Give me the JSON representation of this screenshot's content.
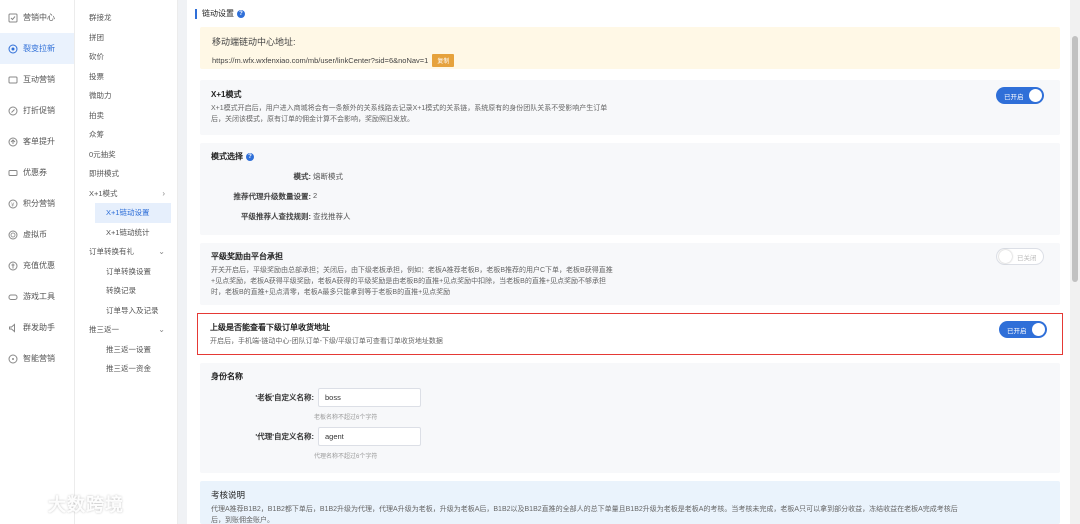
{
  "sidebar_main": {
    "items": [
      {
        "label": "营销中心",
        "icon": "marketing-center-icon"
      },
      {
        "label": "裂变拉新",
        "icon": "fission-icon",
        "active": true
      },
      {
        "label": "互动营销",
        "icon": "interactive-icon"
      },
      {
        "label": "打折促销",
        "icon": "discount-icon"
      },
      {
        "label": "客单提升",
        "icon": "order-up-icon"
      },
      {
        "label": "优惠券",
        "icon": "coupon-icon"
      },
      {
        "label": "积分营销",
        "icon": "points-icon"
      },
      {
        "label": "虚拟币",
        "icon": "virtual-coin-icon"
      },
      {
        "label": "充值优惠",
        "icon": "recharge-icon"
      },
      {
        "label": "游戏工具",
        "icon": "game-tool-icon"
      },
      {
        "label": "群发助手",
        "icon": "broadcast-icon"
      },
      {
        "label": "智能营销",
        "icon": "smart-marketing-icon"
      }
    ]
  },
  "sidebar_sub": {
    "items": [
      "群接龙",
      "拼团",
      "砍价",
      "投票",
      "微助力",
      "拍卖",
      "众筹",
      "0元抽奖",
      "即拼模式"
    ],
    "group_x1": "X+1模式",
    "x1_children": [
      "X+1链动设置",
      "X+1链动统计"
    ],
    "group_order": "订单转换有礼",
    "order_children": [
      "订单转换设置",
      "转换记录",
      "订单导入及记录"
    ],
    "group_push": "推三返一",
    "push_children": [
      "推三返一设置",
      "推三返一资金"
    ]
  },
  "page": {
    "title": "链动设置"
  },
  "url_card": {
    "title": "移动端链动中心地址:",
    "url": "https://m.wfx.wxfenxiao.com/mb/user/linkCenter?sid=6&noNav=1",
    "copy_label": "复制"
  },
  "x1_mode": {
    "title": "X+1模式",
    "desc1": "X+1模式开启后，用户进入商城将会有一条额外的关系线路去记录X+1模式的关系链，系统原有的身份团队关系不受影响产生订单",
    "desc2": "后，关闭该模式，原有订单的佣金计算不会影响，奖励照旧发放。",
    "toggle_label": "已开启"
  },
  "mode_select": {
    "title": "模式选择",
    "mode_key": "模式:",
    "mode_value": "熔断模式",
    "upgrade_key": "推荐代理升级数量设置:",
    "upgrade_value": "2",
    "rule_key": "平级推荐人查找规则:",
    "rule_value": "查找推荐人"
  },
  "peer_reward": {
    "title": "平级奖励由平台承担",
    "desc1": "开关开启后，平级奖励由总部承担；关闭后，由下级老板承担，例如：老板A推荐老板B，老板B推荐的用户C下单，老板B获得直推",
    "desc2": "+见点奖励，老板A获得平级奖励，老板A获得的平级奖励是由老板B的直推+见点奖励中扣除，当老板B的直推+见点奖励不够承担",
    "desc3": "时，老板B的直推+见点清零，老板A最多只能拿到等于老板B的直推+见点奖励",
    "toggle_label": "已关闭"
  },
  "upper_view": {
    "title": "上级是否能查看下级订单收货地址",
    "desc": "开启后，手机端-链动中心-团队订单-下级/平级订单可查看订单收货地址数据",
    "toggle_label": "已开启"
  },
  "identity": {
    "title": "身份名称",
    "boss_label": "'老板'自定义名称:",
    "boss_value": "boss",
    "boss_hint": "老板名称不超过6个字符",
    "agent_label": "'代理'自定义名称:",
    "agent_value": "agent",
    "agent_hint": "代理名称不超过6个字符"
  },
  "exam": {
    "title": "考核说明",
    "desc1": "代理A推荐B1B2，B1B2都下单后，B1B2升级为代理，代理A升级为老板，升级为老板A后，B1B2以及B1B2直推的全部人的总下单量且B1B2升级为老板是老板A的考核。当考核未完成，老板A只可以拿到部分收益，冻结收益在老板A完成考核后",
    "desc2": "后，到账佣金账户。"
  },
  "watermark": {
    "text": "大数跨境"
  },
  "colors": {
    "accent": "#2f6fd8",
    "highlight": "#e53935",
    "url_bg": "#fff8e6"
  }
}
